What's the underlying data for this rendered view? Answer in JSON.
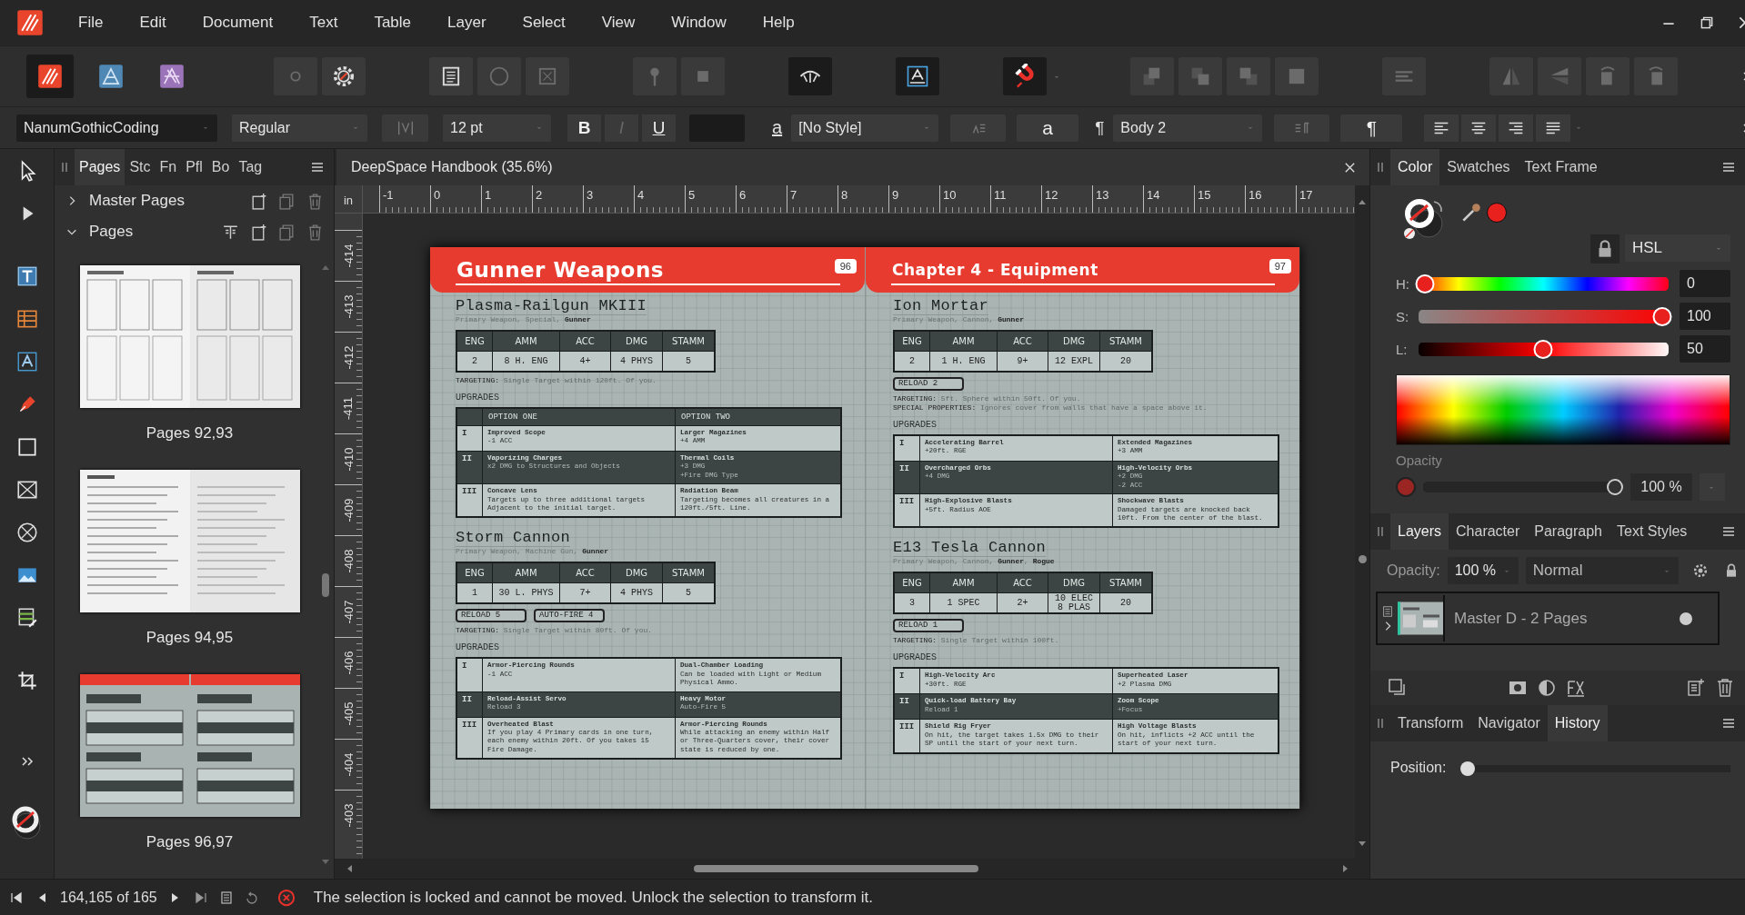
{
  "app_menu": [
    "File",
    "Edit",
    "Document",
    "Text",
    "Table",
    "Layer",
    "Select",
    "View",
    "Window",
    "Help"
  ],
  "toolbar": [
    {
      "items": [
        {
          "kind": "publisher",
          "on": true,
          "disabled": false
        },
        {
          "kind": "designer",
          "on": false,
          "disabled": false
        },
        {
          "kind": "photo",
          "on": false,
          "disabled": false
        }
      ]
    },
    {
      "items": [
        {
          "kind": "dot",
          "on": false,
          "disabled": true
        },
        {
          "kind": "gear",
          "on": false,
          "disabled": false
        }
      ]
    },
    {
      "items": [
        {
          "kind": "frame",
          "on": false,
          "disabled": false
        },
        {
          "kind": "circle",
          "on": false,
          "disabled": true
        },
        {
          "kind": "xbox",
          "on": false,
          "disabled": true
        }
      ]
    },
    {
      "items": [
        {
          "kind": "pin",
          "on": false,
          "disabled": true
        },
        {
          "kind": "square",
          "on": false,
          "disabled": true
        }
      ]
    },
    {
      "items": [
        {
          "kind": "preview",
          "on": true,
          "disabled": false
        }
      ]
    },
    {
      "items": [
        {
          "kind": "textframe",
          "on": true,
          "disabled": false
        }
      ]
    },
    {
      "items": [
        {
          "kind": "magnet",
          "on": true,
          "disabled": false
        },
        {
          "kind": "caret",
          "on": false,
          "disabled": false
        }
      ]
    },
    {
      "items": [
        {
          "kind": "front",
          "on": false,
          "disabled": true
        },
        {
          "kind": "forward",
          "on": false,
          "disabled": true
        },
        {
          "kind": "backward",
          "on": false,
          "disabled": true
        },
        {
          "kind": "back",
          "on": false,
          "disabled": true
        }
      ]
    },
    {
      "items": [
        {
          "kind": "align",
          "on": false,
          "disabled": true
        }
      ]
    },
    {
      "items": [
        {
          "kind": "fliph",
          "on": false,
          "disabled": true
        },
        {
          "kind": "flipv",
          "on": false,
          "disabled": true
        },
        {
          "kind": "rotl",
          "on": false,
          "disabled": true
        },
        {
          "kind": "rotr",
          "on": false,
          "disabled": true
        }
      ]
    }
  ],
  "context_bar": {
    "font_family": "NanumGothicCoding",
    "font_style": "Regular",
    "font_size": "12 pt",
    "format_buttons": [
      {
        "label": "B",
        "kind": "bold",
        "disabled": false
      },
      {
        "label": "I",
        "kind": "italic",
        "disabled": true
      },
      {
        "label": "U",
        "kind": "underline",
        "disabled": false
      }
    ],
    "char_mark": "a",
    "char_style": "[No Style]",
    "char_button": "a",
    "para_mark": "¶",
    "para_style": "Body 2",
    "para_button": "¶"
  },
  "pages_panel": {
    "tabs": [
      {
        "label": "Pages",
        "selected": true
      },
      {
        "label": "Stc",
        "selected": false
      },
      {
        "label": "Fn",
        "selected": false
      },
      {
        "label": "Pfl",
        "selected": false
      },
      {
        "label": "Bo",
        "selected": false
      },
      {
        "label": "Tag",
        "selected": false
      }
    ],
    "sections": [
      {
        "label": "Master Pages",
        "expanded": false
      },
      {
        "label": "Pages",
        "expanded": true
      }
    ],
    "spreads": [
      {
        "label": "Pages 92,93",
        "kind": "tables"
      },
      {
        "label": "Pages 94,95",
        "kind": "text"
      },
      {
        "label": "Pages 96,97",
        "kind": "chapter"
      }
    ]
  },
  "document": {
    "title": "DeepSpace Handbook (35.6%)",
    "ruler": {
      "unit": "in",
      "h_labels": [
        "-1",
        "0",
        "1",
        "2",
        "3",
        "4",
        "5",
        "6",
        "7",
        "8",
        "9",
        "10",
        "11",
        "12",
        "13",
        "14",
        "15",
        "16",
        "17"
      ],
      "v_labels": [
        "-414",
        "-413",
        "-412",
        "-411",
        "-410",
        "-409",
        "-408",
        "-407",
        "-406",
        "-405",
        "-404",
        "-403"
      ]
    },
    "pages": [
      {
        "header": {
          "kind": "section",
          "title": "Gunner Weapons",
          "number": "96"
        },
        "weapons": [
          {
            "name": "Plasma-Railgun MKIII",
            "subtitle": "Primary Weapon, Special, **Gunner**",
            "stat_columns": [
              "ENG",
              "AMM",
              "ACC",
              "DMG",
              "STAMM"
            ],
            "stat_values": [
              "2",
              "8 H. ENG",
              "4+",
              "4 PHYS",
              "5"
            ],
            "notes": [
              "**TARGETING:** Single Target within 120ft. Of you."
            ],
            "upgrades_label": "UPGRADES",
            "option_headers": [
              "OPTION ONE",
              "OPTION TWO"
            ],
            "upgrades": [
              {
                "tier": "I",
                "options": [
                  {
                    "title": "Improved Scope",
                    "detail": "-1 ACC"
                  },
                  {
                    "title": "Larger Magazines",
                    "detail": "+4 AMM"
                  }
                ]
              },
              {
                "tier": "II",
                "options": [
                  {
                    "title": "Vaporizing Charges",
                    "detail": "x2 DMG to Structures and Objects"
                  },
                  {
                    "title": "Thermal Coils",
                    "detail": "+3 DMG\n+Fire DMG Type"
                  }
                ]
              },
              {
                "tier": "III",
                "options": [
                  {
                    "title": "Concave Lens",
                    "detail": "Targets up to three additional targets\nAdjacent to the initial target."
                  },
                  {
                    "title": "Radiation Beam",
                    "detail": "Targeting becomes all creatures in a\n120ft./5ft. Line."
                  }
                ]
              }
            ]
          },
          {
            "name": "Storm Cannon",
            "subtitle": "Primary Weapon, Machine Gun, **Gunner**",
            "stat_columns": [
              "ENG",
              "AMM",
              "ACC",
              "DMG",
              "STAMM"
            ],
            "stat_values": [
              "1",
              "30 L. PHYS",
              "7+",
              "4 PHYS",
              "5"
            ],
            "tags": [
              "RELOAD 5",
              "AUTO-FIRE 4"
            ],
            "notes": [
              "**TARGETING:** Single Target within 80ft. Of you."
            ],
            "upgrades_label": "UPGRADES",
            "upgrades": [
              {
                "tier": "I",
                "options": [
                  {
                    "title": "Armor-Piercing Rounds",
                    "detail": "-1 ACC"
                  },
                  {
                    "title": "Dual-Chamber Loading",
                    "detail": "Can be loaded with Light or Medium\nPhysical Ammo."
                  }
                ]
              },
              {
                "tier": "II",
                "options": [
                  {
                    "title": "Reload-Assist Servo",
                    "detail": "Reload 3"
                  },
                  {
                    "title": "Heavy Motor",
                    "detail": "Auto-Fire 5"
                  }
                ]
              },
              {
                "tier": "III",
                "options": [
                  {
                    "title": "Overheated Blast",
                    "detail": "If you play 4 Primary cards in one turn,\neach enemy within 20ft. Of you takes 15\nFire Damage."
                  },
                  {
                    "title": "Armor-Piercing Rounds",
                    "detail": "While attacking an enemy within Half\nor Three-Quarters cover, their cover\nstate is reduced by one."
                  }
                ]
              }
            ]
          }
        ]
      },
      {
        "header": {
          "kind": "chapter",
          "title": "Chapter 4 - Equipment",
          "number": "97"
        },
        "weapons": [
          {
            "name": "Ion Mortar",
            "subtitle": "Primary Weapon, Cannon, **Gunner**",
            "stat_columns": [
              "ENG",
              "AMM",
              "ACC",
              "DMG",
              "STAMM"
            ],
            "stat_values": [
              "2",
              "1 H. ENG",
              "9+",
              "12 EXPL",
              "20"
            ],
            "tags": [
              "RELOAD 2"
            ],
            "notes": [
              "**TARGETING:** 5ft. Sphere within 50ft. Of you.",
              "**SPECIAL PROPERTIES:** Ignores cover from walls that have a space above it."
            ],
            "upgrades_label": "UPGRADES",
            "upgrades": [
              {
                "tier": "I",
                "options": [
                  {
                    "title": "Accelerating Barrel",
                    "detail": "+20ft. RGE"
                  },
                  {
                    "title": "Extended Magazines",
                    "detail": "+3 AMM"
                  }
                ]
              },
              {
                "tier": "II",
                "options": [
                  {
                    "title": "Overcharged Orbs",
                    "detail": "+4 DMG"
                  },
                  {
                    "title": "High-Velocity Orbs",
                    "detail": "+2 DMG\n-2 ACC"
                  }
                ]
              },
              {
                "tier": "III",
                "options": [
                  {
                    "title": "High-Explosive Blasts",
                    "detail": "+5ft. Radius AOE"
                  },
                  {
                    "title": "Shockwave Blasts",
                    "detail": "Damaged targets are knocked back\n10ft. From the center of the blast."
                  }
                ]
              }
            ]
          },
          {
            "name": "E13 Tesla Cannon",
            "subtitle": "Primary Weapon, Cannon, **Gunner**, **Rogue**",
            "stat_columns": [
              "ENG",
              "AMM",
              "ACC",
              "DMG",
              "STAMM"
            ],
            "stat_values": [
              "3",
              "1 SPEC",
              "2+",
              "10 ELEC\n8 PLAS",
              "20"
            ],
            "tags": [
              "RELOAD 1"
            ],
            "notes": [
              "**TARGETING:** Single Target within 100ft."
            ],
            "upgrades_label": "UPGRADES",
            "upgrades": [
              {
                "tier": "I",
                "options": [
                  {
                    "title": "High-Velocity Arc",
                    "detail": "+30ft. RGE"
                  },
                  {
                    "title": "Superheated Laser",
                    "detail": "+2 Plasma DMG"
                  }
                ]
              },
              {
                "tier": "II",
                "options": [
                  {
                    "title": "Quick-load Battery Bay",
                    "detail": "Reload 1"
                  },
                  {
                    "title": "Zoom Scope",
                    "detail": "+Focus"
                  }
                ]
              },
              {
                "tier": "III",
                "options": [
                  {
                    "title": "Shield Rig Fryer",
                    "detail": "On hit, the target takes 1.5x DMG to their\nSP until the start of your next turn."
                  },
                  {
                    "title": "High Voltage Blasts",
                    "detail": "On hit, inflicts +2 ACC until the\nstart of your next turn."
                  }
                ]
              }
            ]
          }
        ]
      }
    ]
  },
  "color_panel": {
    "tabs": [
      {
        "label": "Color",
        "selected": true
      },
      {
        "label": "Swatches",
        "selected": false
      },
      {
        "label": "Text Frame",
        "selected": false
      }
    ],
    "model": "HSL",
    "sliders": [
      {
        "kind": "hue",
        "label": "H:",
        "level": 0,
        "value": "0"
      },
      {
        "kind": "saturation",
        "label": "S:",
        "level": 1,
        "value": "100"
      },
      {
        "kind": "lightness",
        "label": "L:",
        "level": 0.5,
        "value": "50"
      }
    ],
    "opacity": {
      "label": "Opacity",
      "level": 1,
      "value": "100 %"
    }
  },
  "layers_panel": {
    "tabs": [
      {
        "label": "Layers",
        "selected": true
      },
      {
        "label": "Character",
        "selected": false
      },
      {
        "label": "Paragraph",
        "selected": false
      },
      {
        "label": "Text Styles",
        "selected": false
      }
    ],
    "opacity_label": "Opacity:",
    "opacity": "100 %",
    "blend_mode": "Normal",
    "layers": [
      {
        "name": "Master D - 2 Pages",
        "visible": true
      }
    ]
  },
  "history_panel": {
    "tabs": [
      {
        "label": "Transform",
        "selected": false
      },
      {
        "label": "Navigator",
        "selected": false
      },
      {
        "label": "History",
        "selected": true
      }
    ],
    "position_label": "Position:",
    "position": {
      "level": 0
    }
  },
  "status_bar": {
    "page_position": "164,165 of 165",
    "message": "The selection is locked and cannot be moved. Unlock the selection to transform it."
  }
}
